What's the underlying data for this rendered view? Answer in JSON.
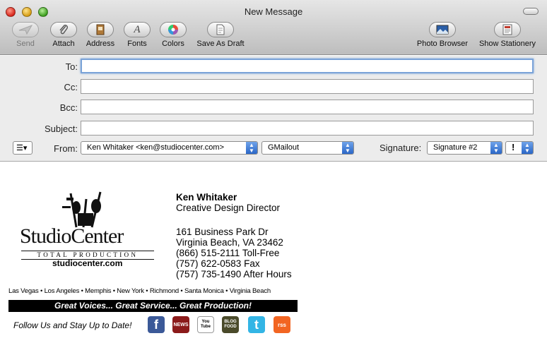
{
  "window": {
    "title": "New Message"
  },
  "toolbar": {
    "send": "Send",
    "attach": "Attach",
    "address": "Address",
    "fonts": "Fonts",
    "colors": "Colors",
    "save_draft": "Save As Draft",
    "photo_browser": "Photo Browser",
    "show_stationery": "Show Stationery"
  },
  "headers": {
    "to_label": "To:",
    "cc_label": "Cc:",
    "bcc_label": "Bcc:",
    "subject_label": "Subject:",
    "from_label": "From:",
    "from_value": "Ken Whitaker <ken@studiocenter.com>",
    "account_value": "GMailout",
    "signature_label": "Signature:",
    "signature_value": "Signature #2",
    "priority_symbol": "!"
  },
  "signature": {
    "logo_word": "StudioCenter",
    "logo_subtitle": "TOTAL PRODUCTION",
    "website": "studiocenter.com",
    "name": "Ken Whitaker",
    "title": "Creative Design Director",
    "address1": "161 Business Park Dr",
    "address2": "Virginia Beach, VA 23462",
    "phone_tollfree": "(866) 515-2111 Toll-Free",
    "fax": "(757) 622-0583  Fax",
    "after_hours": "(757) 735-1490 After Hours",
    "cities": "Las Vegas • Los Angeles • Memphis • New York • Richmond • Santa Monica • Virginia Beach",
    "tagline": "Great Voices... Great Service... Great Production!",
    "follow": "Follow Us and Stay Up to Date!"
  },
  "social": {
    "facebook": "f",
    "news": "NEWS",
    "youtube": "You Tube",
    "blog": "BLOG FOOD",
    "twitter": "t",
    "rss": "rss"
  },
  "colors": {
    "focus": "#7aa3d8",
    "popup_arrow": "#2a66c7",
    "banner": "#000000"
  }
}
